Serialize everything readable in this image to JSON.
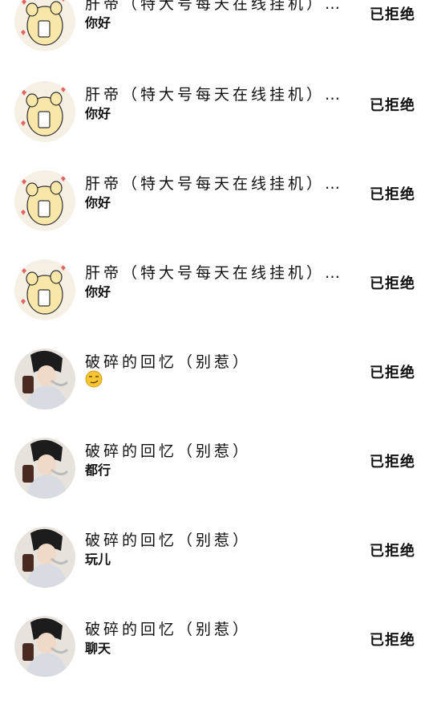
{
  "requests": [
    {
      "name": "肝帝（特大号每天在线挂机）大…",
      "message": "你好",
      "status": "已拒绝",
      "avatar": "bear-avatar"
    },
    {
      "name": "肝帝（特大号每天在线挂机）大…",
      "message": "你好",
      "status": "已拒绝",
      "avatar": "bear-avatar"
    },
    {
      "name": "肝帝（特大号每天在线挂机）大…",
      "message": "你好",
      "status": "已拒绝",
      "avatar": "bear-avatar"
    },
    {
      "name": "肝帝（特大号每天在线挂机）大…",
      "message": "你好",
      "status": "已拒绝",
      "avatar": "bear-avatar"
    },
    {
      "name": "破碎的回忆（别惹）",
      "message": "",
      "message_icon": "smirk-emoji",
      "status": "已拒绝",
      "avatar": "person-avatar"
    },
    {
      "name": "破碎的回忆（别惹）",
      "message": "都行",
      "status": "已拒绝",
      "avatar": "person-avatar"
    },
    {
      "name": "破碎的回忆（别惹）",
      "message": "玩儿",
      "status": "已拒绝",
      "avatar": "person-avatar"
    },
    {
      "name": "破碎的回忆（别惹）",
      "message": "聊天",
      "status": "已拒绝",
      "avatar": "person-avatar"
    }
  ]
}
